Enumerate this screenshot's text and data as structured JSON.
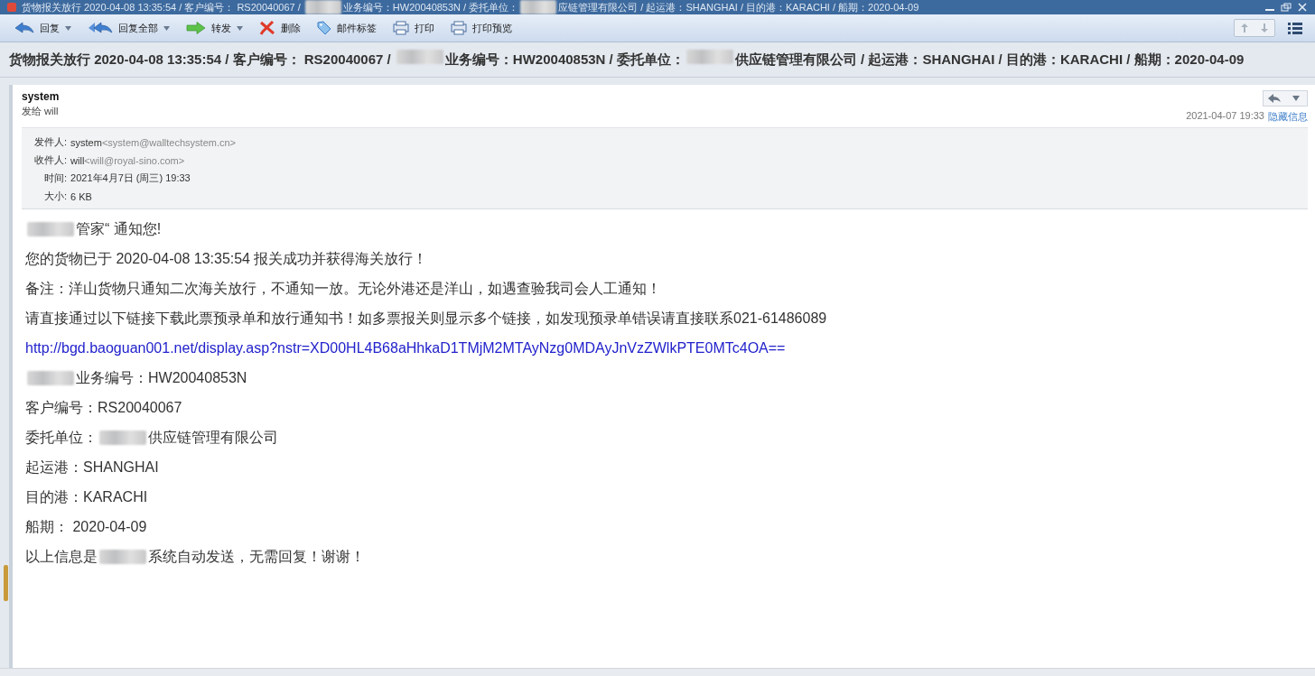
{
  "title_bar": {
    "parts": [
      {
        "kind": "text",
        "text": "货物报关放行 2020-04-08 13:35:54 / 客户编号： RS20040067 / "
      },
      {
        "kind": "redacted"
      },
      {
        "kind": "text",
        "text": "业务编号：HW20040853N / 委托单位："
      },
      {
        "kind": "redacted"
      },
      {
        "kind": "text",
        "text": "应链管理有限公司 / 起运港：SHANGHAI / 目的港：KARACHI / 船期：2020-04-09"
      }
    ]
  },
  "toolbar": {
    "buttons": [
      {
        "label": "回复",
        "dropdown": true
      },
      {
        "label": "回复全部",
        "dropdown": true
      },
      {
        "label": "转发",
        "dropdown": true
      },
      {
        "label": "删除",
        "dropdown": false
      },
      {
        "label": "邮件标签",
        "dropdown": false
      },
      {
        "label": "打印",
        "dropdown": false
      },
      {
        "label": "打印预览",
        "dropdown": false
      }
    ]
  },
  "subject": {
    "parts": [
      {
        "kind": "text",
        "text": "货物报关放行 2020-04-08 13:35:54 / 客户编号： RS20040067 / "
      },
      {
        "kind": "redacted"
      },
      {
        "kind": "text",
        "text": "业务编号：HW20040853N / 委托单位："
      },
      {
        "kind": "redacted"
      },
      {
        "kind": "text",
        "text": "供应链管理有限公司 / 起运港：SHANGHAI / 目的港：KARACHI / 船期：2020-04-09"
      }
    ]
  },
  "message": {
    "sender": "system",
    "to": "发给 will",
    "date": "2021-04-07 19:33",
    "hide_link": "隐藏信息",
    "details": [
      {
        "label": "发件人:",
        "name": "system",
        "address": "<system@walltechsystem.cn>"
      },
      {
        "label": "收件人:",
        "name": "will",
        "address": "<will@royal-sino.com>"
      },
      {
        "label": "时间:",
        "name": "2021年4月7日 (周三) 19:33"
      },
      {
        "label": "大小:",
        "name": "6 KB"
      }
    ],
    "body": [
      {
        "kind": "text",
        "parts": [
          {
            "kind": "redacted"
          },
          {
            "kind": "text",
            "text": "管家“ 通知您!"
          }
        ]
      },
      {
        "kind": "text",
        "parts": [
          {
            "kind": "text",
            "text": "您的货物已于 2020-04-08 13:35:54 报关成功并获得海关放行！"
          }
        ]
      },
      {
        "kind": "text",
        "parts": [
          {
            "kind": "text",
            "text": "备注：洋山货物只通知二次海关放行，不通知一放。无论外港还是洋山，如遇查验我司会人工通知！"
          }
        ]
      },
      {
        "kind": "text",
        "parts": [
          {
            "kind": "text",
            "text": "请直接通过以下链接下载此票预录单和放行通知书！如多票报关则显示多个链接，如发现预录单错误请直接联系021-61486089"
          }
        ]
      },
      {
        "kind": "link",
        "parts": [
          {
            "kind": "text",
            "text": "http://bgd.baoguan001.net/display.asp?nstr=XD00HL4B68aHhkaD1TMjM2MTAyNzg0MDAyJnVzZWlkPTE0MTc4OA=="
          }
        ]
      },
      {
        "kind": "text",
        "parts": [
          {
            "kind": "redacted"
          },
          {
            "kind": "text",
            "text": "业务编号：HW20040853N"
          }
        ]
      },
      {
        "kind": "text",
        "parts": [
          {
            "kind": "text",
            "text": "客户编号：RS20040067"
          }
        ]
      },
      {
        "kind": "text",
        "parts": [
          {
            "kind": "text",
            "text": "委托单位："
          },
          {
            "kind": "redacted"
          },
          {
            "kind": "text",
            "text": "供应链管理有限公司"
          }
        ]
      },
      {
        "kind": "text",
        "parts": [
          {
            "kind": "text",
            "text": "起运港：SHANGHAI"
          }
        ]
      },
      {
        "kind": "text",
        "parts": [
          {
            "kind": "text",
            "text": "目的港：KARACHI"
          }
        ]
      },
      {
        "kind": "text",
        "parts": [
          {
            "kind": "text",
            "text": "船期： 2020-04-09"
          }
        ]
      },
      {
        "kind": "text",
        "parts": [
          {
            "kind": "text",
            "text": "以上信息是"
          },
          {
            "kind": "redacted"
          },
          {
            "kind": "text",
            "text": "系统自动发送，无需回复！谢谢！"
          }
        ]
      }
    ]
  }
}
